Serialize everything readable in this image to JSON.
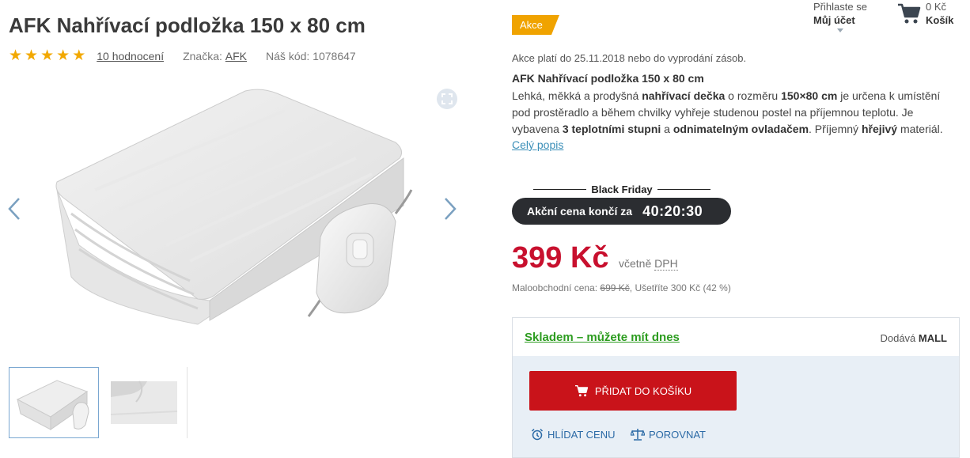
{
  "product": {
    "title": "AFK Nahřívací podložka 150 x 80 cm",
    "rating_stars": 5,
    "reviews_label": "10 hodnocení",
    "brand_label": "Značka:",
    "brand": "AFK",
    "code_label": "Náš kód:",
    "code": "1078647"
  },
  "gallery": {
    "thumbnail_count": 2,
    "selected_index": 0
  },
  "header": {
    "login_label": "Přihlaste se",
    "account_label": "Můj účet",
    "cart_amount": "0 Kč",
    "cart_label": "Košík"
  },
  "promo": {
    "badge": "Akce",
    "validity": "Akce platí do 25.11.2018 nebo do vyprodání zásob.",
    "event_label": "Black Friday",
    "countdown_label": "Akční cena končí za",
    "countdown_time": "40:20:30"
  },
  "description": {
    "title": "AFK Nahřívací podložka 150 x 80 cm",
    "p1": "Lehká, měkká a prodyšná ",
    "b1": "nahřívací dečka",
    "p2": " o rozměru ",
    "b2": "150×80 cm",
    "p3": " je určena k umístění pod prostěradlo a během chvilky vyhřeje studenou postel na příjemnou teplotu. Je vybavena ",
    "b3": "3 teplotními stupni",
    "p4": " a ",
    "b4": "odnimatelným ovladačem",
    "p5": ". Příjemný ",
    "b5": "hřejivý",
    "p6": " materiál.",
    "more_link": "Celý popis"
  },
  "pricing": {
    "price": "399 Kč",
    "vat_prefix": "včetně ",
    "vat_abbr": "DPH",
    "retail_label": "Maloobchodní cena: ",
    "retail_price": "699 Kč",
    "savings": ", Ušetříte 300 Kč (42 %)"
  },
  "purchase": {
    "stock_status": "Skladem – můžete mít dnes",
    "supplier_label": "Dodává ",
    "supplier": "MALL",
    "add_to_cart": "PŘIDAT DO KOŠÍKU",
    "watch_price": "HLÍDAT CENU",
    "compare": "POROVNAT"
  },
  "colors": {
    "price_red": "#c8102e",
    "button_red": "#c9131a",
    "badge_orange": "#f0a300",
    "stock_green": "#2c9c1f",
    "link_blue": "#3b8fb8",
    "countdown_bg": "#2b2d31"
  },
  "icons": [
    "star-icon",
    "expand-icon",
    "chevron-left-icon",
    "chevron-right-icon",
    "cart-icon",
    "alarm-clock-icon",
    "scales-icon"
  ]
}
